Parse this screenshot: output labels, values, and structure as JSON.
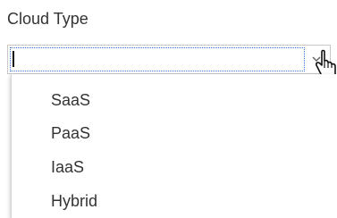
{
  "field": {
    "label": "Cloud Type",
    "value": ""
  },
  "dropdown": {
    "options": [
      "SaaS",
      "PaaS",
      "IaaS",
      "Hybrid"
    ]
  },
  "icons": {
    "chevron": "chevron-down-icon",
    "cursor": "hand-pointer-icon"
  },
  "colors": {
    "focus_outline": "#3a7bd5",
    "text": "#333333"
  }
}
